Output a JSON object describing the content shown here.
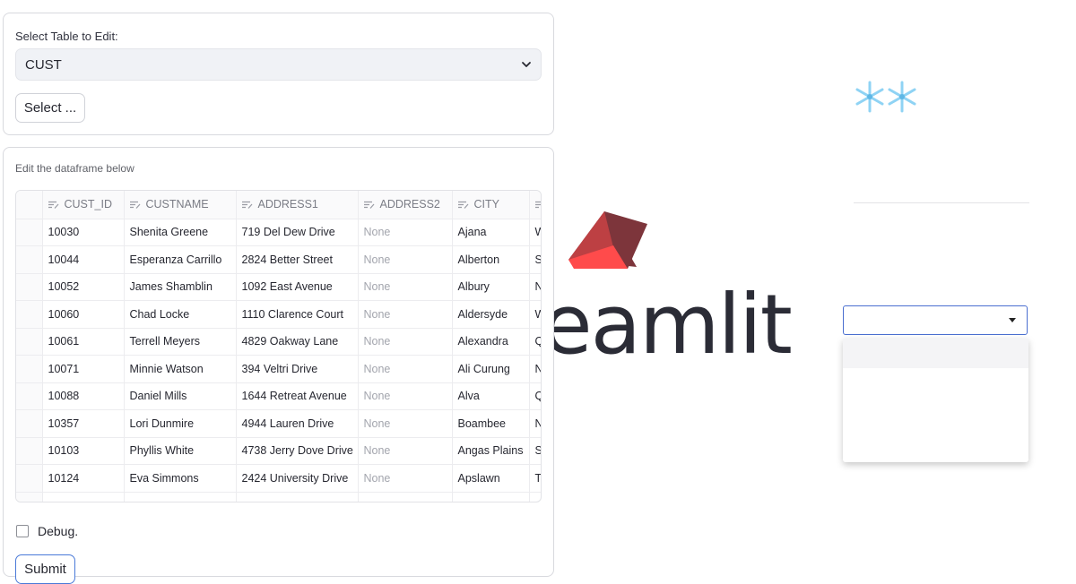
{
  "background": {
    "logo_text": "eamlit",
    "snowflakes": "❄❄"
  },
  "table_select_form": {
    "label": "Select Table to Edit:",
    "selected_value": "CUST",
    "button_label": "Select ..."
  },
  "editor_form": {
    "caption": "Edit the dataframe below",
    "columns": [
      "CUST_ID",
      "CUSTNAME",
      "ADDRESS1",
      "ADDRESS2",
      "CITY",
      ""
    ],
    "rows": [
      [
        "10030",
        "Shenita Greene",
        "719 Del Dew Drive",
        "None",
        "Ajana",
        "W"
      ],
      [
        "10044",
        "Esperanza Carrillo",
        "2824 Better Street",
        "None",
        "Alberton",
        "S"
      ],
      [
        "10052",
        "James Shamblin",
        "1092 East Avenue",
        "None",
        "Albury",
        "N"
      ],
      [
        "10060",
        "Chad Locke",
        "1110 Clarence Court",
        "None",
        "Aldersyde",
        "W"
      ],
      [
        "10061",
        "Terrell Meyers",
        "4829 Oakway Lane",
        "None",
        "Alexandra",
        "Q"
      ],
      [
        "10071",
        "Minnie Watson",
        "394 Veltri Drive",
        "None",
        "Ali Curung",
        "N"
      ],
      [
        "10088",
        "Daniel Mills",
        "1644 Retreat Avenue",
        "None",
        "Alva",
        "Q"
      ],
      [
        "10357",
        "Lori Dunmire",
        "4944 Lauren Drive",
        "None",
        "Boambee",
        "N"
      ],
      [
        "10103",
        "Phyllis White",
        "4738 Jerry Dove Drive",
        "None",
        "Angas Plains",
        "S"
      ],
      [
        "10124",
        "Eva Simmons",
        "2424 University Drive",
        "None",
        "Apslawn",
        "T"
      ]
    ],
    "debug_label": "Debug.",
    "debug_checked": false,
    "submit_label": "Submit"
  },
  "colors": {
    "crown_light": "#ff4b4b",
    "crown_mid": "#bd4043",
    "crown_dark": "#7d353b",
    "snowflake": "#8fd3f4",
    "submit_border": "#4a7ad8"
  }
}
